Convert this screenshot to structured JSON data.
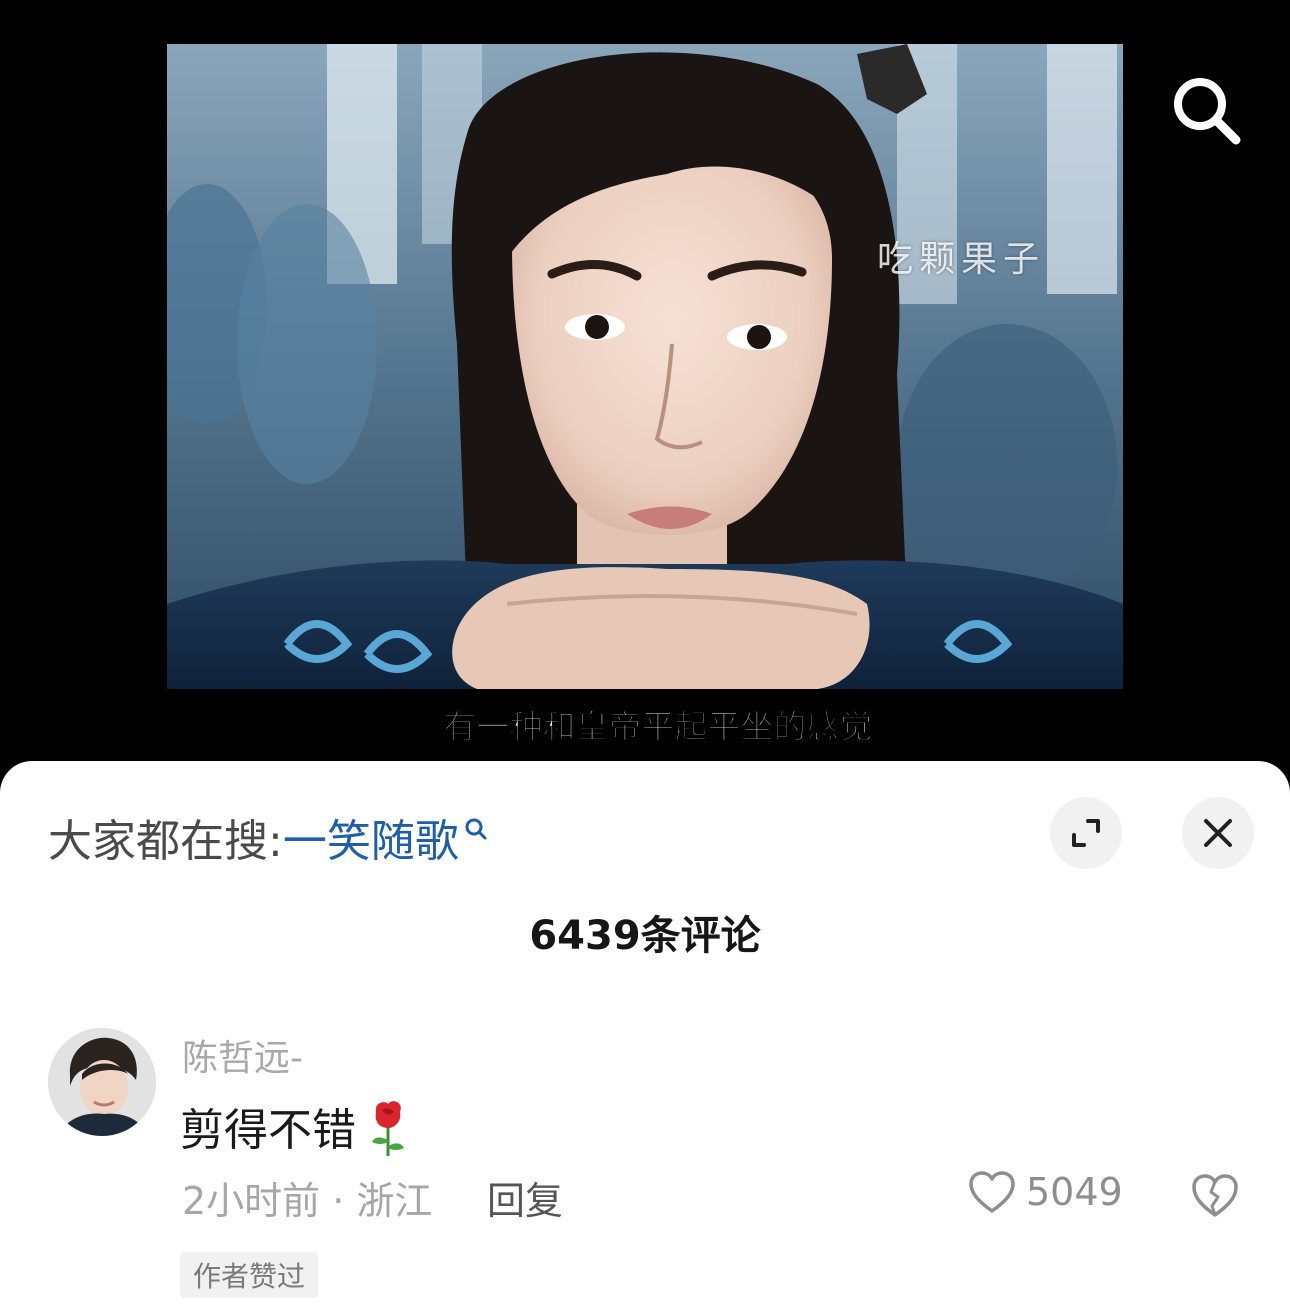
{
  "video": {
    "watermark": "吃颗果子",
    "subtitle": "有一种和皇帝平起平坐的感觉",
    "search_icon": "search-icon"
  },
  "sheet": {
    "trending_label": "大家都在搜:",
    "trending_term": "一笑随歌",
    "comment_count": "6439条评论",
    "expand_icon": "expand-icon",
    "close_icon": "close-icon"
  },
  "comments": [
    {
      "username": "陈哲远-",
      "text": "剪得不错",
      "emoji": "rose-emoji",
      "meta": "2小时前 · 浙江",
      "reply_label": "回复",
      "like_count": "5049",
      "badge": "作者赞过"
    }
  ],
  "colors": {
    "link_blue": "#1f5fa8",
    "muted_gray": "#a6a6a6",
    "sheet_bg": "#ffffff"
  }
}
